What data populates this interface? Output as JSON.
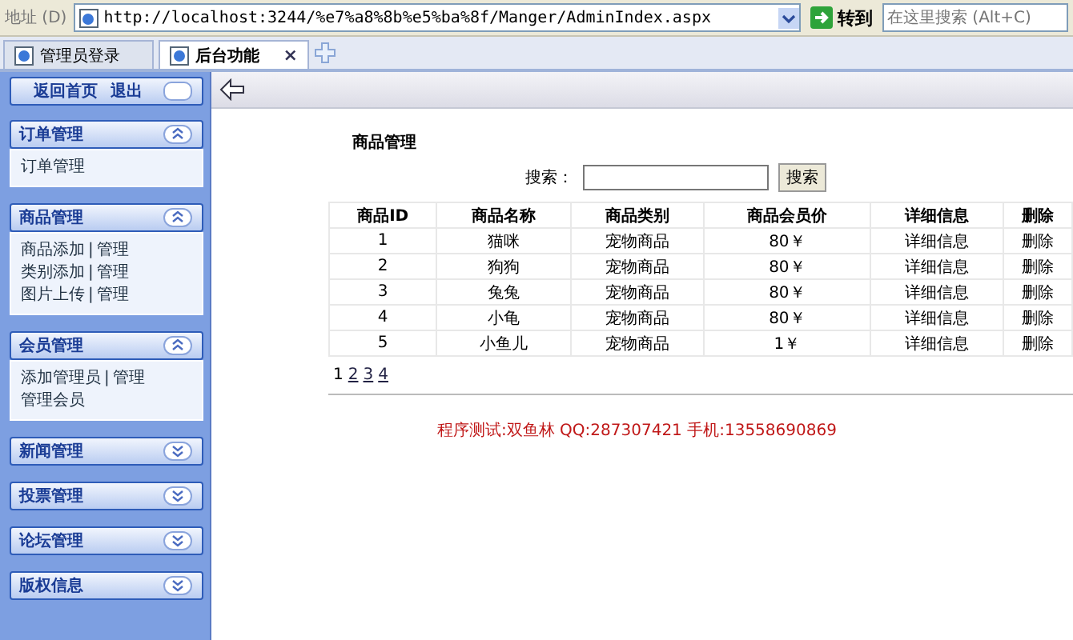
{
  "address_bar": {
    "label": "地址 (D)",
    "url": "http://localhost:3244/%e7%a8%8b%e5%ba%8f/Manger/AdminIndex.aspx",
    "go_button": "转到",
    "search_placeholder": "在这里搜索 (Alt+C)"
  },
  "tabs": [
    {
      "label": "管理员登录",
      "selected": false
    },
    {
      "label": "后台功能",
      "selected": true
    }
  ],
  "tab_close": "×",
  "sidebar": {
    "top_links": [
      "返回首页",
      "退出"
    ],
    "groups": [
      {
        "title": "订单管理",
        "expanded": true,
        "items": [
          {
            "links": [
              "订单管理"
            ]
          }
        ]
      },
      {
        "title": "商品管理",
        "expanded": true,
        "items": [
          {
            "links": [
              "商品添加",
              "管理"
            ],
            "separator": "|"
          },
          {
            "links": [
              "类别添加",
              "管理"
            ],
            "separator": "|"
          },
          {
            "links": [
              "图片上传",
              "管理"
            ],
            "separator": "|"
          }
        ]
      },
      {
        "title": "会员管理",
        "expanded": true,
        "items": [
          {
            "links": [
              "添加管理员",
              "管理"
            ],
            "separator": "|"
          },
          {
            "links": [
              "管理会员"
            ]
          }
        ]
      },
      {
        "title": "新闻管理",
        "expanded": false
      },
      {
        "title": "投票管理",
        "expanded": false
      },
      {
        "title": "论坛管理",
        "expanded": false
      },
      {
        "title": "版权信息",
        "expanded": false
      }
    ]
  },
  "content": {
    "title": "商品管理",
    "search_label": "搜索：",
    "search_button": "搜索",
    "table": {
      "columns": [
        "商品ID",
        "商品名称",
        "商品类别",
        "商品会员价",
        "详细信息",
        "删除"
      ],
      "rows": [
        [
          "1",
          "猫咪",
          "宠物商品",
          "80￥",
          "详细信息",
          "删除"
        ],
        [
          "2",
          "狗狗",
          "宠物商品",
          "80￥",
          "详细信息",
          "删除"
        ],
        [
          "3",
          "兔兔",
          "宠物商品",
          "80￥",
          "详细信息",
          "删除"
        ],
        [
          "4",
          "小龟",
          "宠物商品",
          "80￥",
          "详细信息",
          "删除"
        ],
        [
          "5",
          "小鱼儿",
          "宠物商品",
          "1￥",
          "详细信息",
          "删除"
        ]
      ]
    },
    "pages": [
      {
        "label": "1",
        "selected": true
      },
      {
        "label": "2",
        "selected": false
      },
      {
        "label": "3",
        "selected": false
      },
      {
        "label": "4",
        "selected": false
      }
    ],
    "footer": "程序测试:双鱼林 QQ:287307421 手机:13558690869"
  }
}
